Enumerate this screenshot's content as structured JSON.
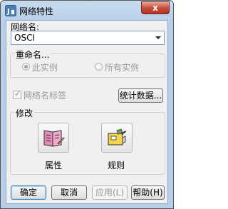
{
  "window": {
    "title": "网络特性",
    "close_glyph": "x"
  },
  "net_name": {
    "label": "网络名:",
    "value": "OSCI"
  },
  "rename": {
    "group_label": "重命名...",
    "option_this": "此实例",
    "option_all": "所有实例"
  },
  "net_label_checkbox": {
    "label": "网络名标签",
    "checked": true
  },
  "stats_button": "统计数据...",
  "modify": {
    "group_label": "修改",
    "properties_label": "属性",
    "rules_label": "规则"
  },
  "footer": {
    "ok": "确定",
    "cancel": "取消",
    "apply": "应用(L)",
    "help": "帮助(H)"
  },
  "colors": {
    "accent": "#3c7fb1",
    "close": "#c74f3a",
    "frame": "#b7cfe8"
  }
}
